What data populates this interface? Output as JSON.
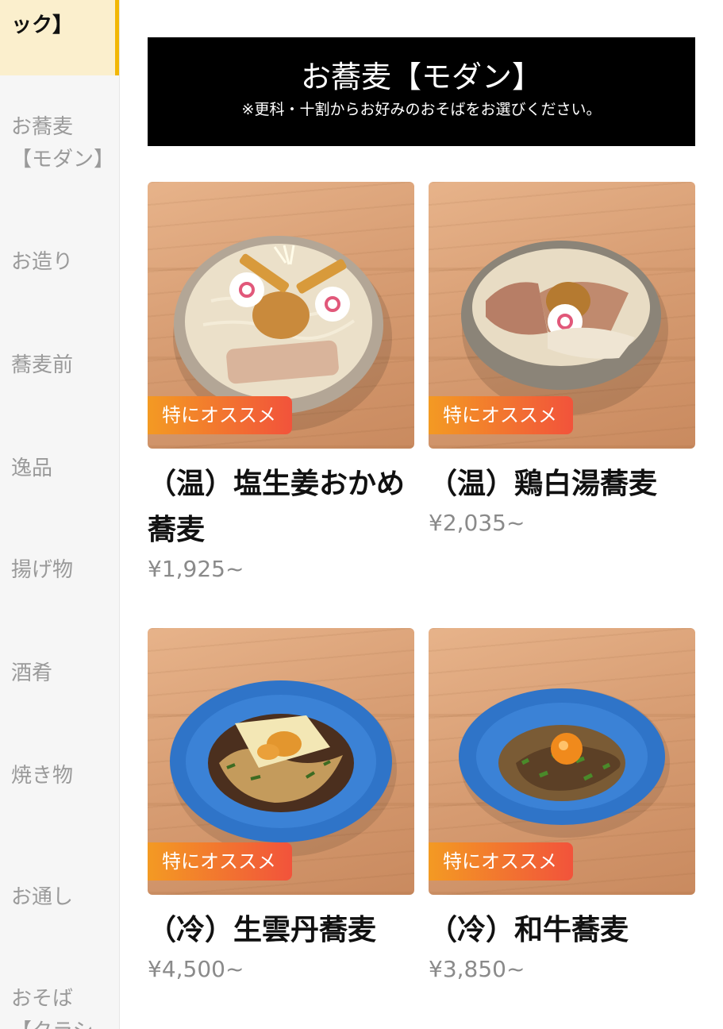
{
  "sidebar": {
    "items": [
      {
        "label": "ック】"
      },
      {
        "label": "お蕎麦\n【モダン】"
      },
      {
        "label": "お造り"
      },
      {
        "label": "蕎麦前"
      },
      {
        "label": "逸品"
      },
      {
        "label": "揚げ物"
      },
      {
        "label": "酒肴"
      },
      {
        "label": "焼き物"
      },
      {
        "label": "お通し"
      },
      {
        "label": "おそば\n【クラシ"
      }
    ]
  },
  "banner": {
    "title": "お蕎麦【モダン】",
    "subtitle": "※更科・十割からお好みのおそばをお選びください。"
  },
  "items": [
    {
      "badge": "特にオススメ",
      "name": "（温）塩生姜おかめ蕎麦",
      "price": "¥1,925~",
      "bowl": "beige"
    },
    {
      "badge": "特にオススメ",
      "name": "（温）鶏白湯蕎麦",
      "price": "¥2,035~",
      "bowl": "beige"
    },
    {
      "badge": "特にオススメ",
      "name": "（冷）生雲丹蕎麦",
      "price": "¥4,500~",
      "bowl": "blue"
    },
    {
      "badge": "特にオススメ",
      "name": "（冷）和牛蕎麦",
      "price": "¥3,850~",
      "bowl": "blue"
    }
  ],
  "colors": {
    "accent": "#f2b705",
    "badge_start": "#f39a23",
    "badge_end": "#f2533b",
    "banner_bg": "#000000"
  }
}
